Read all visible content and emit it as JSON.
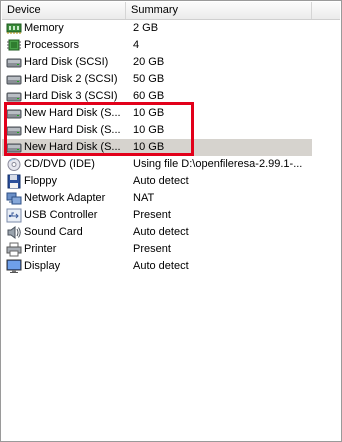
{
  "columns": {
    "device": "Device",
    "summary": "Summary"
  },
  "devices": [
    {
      "name": "Memory",
      "summary": "2 GB",
      "icon": "memory-icon"
    },
    {
      "name": "Processors",
      "summary": "4",
      "icon": "processor-icon"
    },
    {
      "name": "Hard Disk (SCSI)",
      "summary": "20 GB",
      "icon": "hard-disk-icon"
    },
    {
      "name": "Hard Disk 2 (SCSI)",
      "summary": "50 GB",
      "icon": "hard-disk-icon"
    },
    {
      "name": "Hard Disk 3 (SCSI)",
      "summary": "60 GB",
      "icon": "hard-disk-icon"
    },
    {
      "name": "New Hard Disk (S...",
      "summary": "10 GB",
      "icon": "hard-disk-icon"
    },
    {
      "name": "New Hard Disk (S...",
      "summary": "10 GB",
      "icon": "hard-disk-icon"
    },
    {
      "name": "New Hard Disk (S...",
      "summary": "10 GB",
      "icon": "hard-disk-icon",
      "selected": true
    },
    {
      "name": "CD/DVD (IDE)",
      "summary": "Using file D:\\openfileresa-2.99.1-...",
      "icon": "cd-dvd-icon"
    },
    {
      "name": "Floppy",
      "summary": "Auto detect",
      "icon": "floppy-icon"
    },
    {
      "name": "Network Adapter",
      "summary": "NAT",
      "icon": "network-adapter-icon"
    },
    {
      "name": "USB Controller",
      "summary": "Present",
      "icon": "usb-icon"
    },
    {
      "name": "Sound Card",
      "summary": "Auto detect",
      "icon": "sound-card-icon"
    },
    {
      "name": "Printer",
      "summary": "Present",
      "icon": "printer-icon"
    },
    {
      "name": "Display",
      "summary": "Auto detect",
      "icon": "display-icon"
    }
  ],
  "colors": {
    "selection": "#d6d3ce",
    "highlight_box": "#e2001a"
  }
}
